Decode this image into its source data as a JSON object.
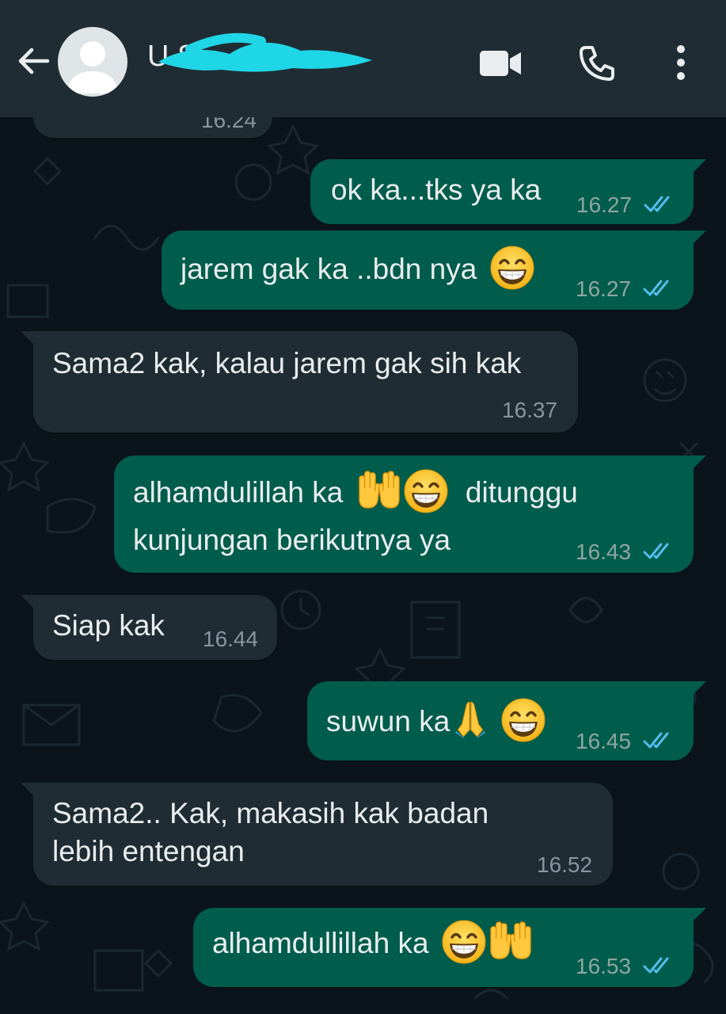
{
  "header": {
    "contact_name": "U                    S",
    "back_icon": "arrow-left-icon",
    "video_icon": "video-camera-icon",
    "call_icon": "phone-icon",
    "menu_icon": "more-vertical-icon"
  },
  "colors": {
    "header_bg": "#202c33",
    "chat_bg": "#0b141a",
    "outgoing_bubble": "#005c4b",
    "incoming_bubble": "#202c33",
    "read_ticks": "#53bdeb",
    "redaction": "#1fd6e6"
  },
  "messages": [
    {
      "direction": "in",
      "lines": [
        "",
        ""
      ],
      "time": "16.24"
    },
    {
      "direction": "out",
      "lines": [
        "ok ka...tks ya ka"
      ],
      "time": "16.27",
      "status": "read"
    },
    {
      "direction": "out",
      "lines": [
        "jarem gak ka ..bdn nya"
      ],
      "emojis": [
        "grinning-face-smiling-eyes"
      ],
      "time": "16.27",
      "status": "read"
    },
    {
      "direction": "in",
      "lines": [
        "Sama2 kak, kalau jarem gak sih kak"
      ],
      "time": "16.37"
    },
    {
      "direction": "out",
      "lines": [
        "alhamdulillah ka",
        "ditunggu",
        "kunjungan berikutnya ya"
      ],
      "emojis": [
        "palms-up-together",
        "grinning-face-smiling-eyes"
      ],
      "time": "16.43",
      "status": "read"
    },
    {
      "direction": "in",
      "lines": [
        "Siap kak"
      ],
      "time": "16.44"
    },
    {
      "direction": "out",
      "lines": [
        "suwun ka"
      ],
      "emojis": [
        "folded-hands",
        "grinning-face-smiling-eyes"
      ],
      "time": "16.45",
      "status": "read"
    },
    {
      "direction": "in",
      "lines": [
        "Sama2.. Kak, makasih kak badan",
        "lebih entengan"
      ],
      "time": "16.52"
    },
    {
      "direction": "out",
      "lines": [
        "alhamdullillah ka"
      ],
      "emojis": [
        "grinning-face-smiling-eyes",
        "palms-up-together"
      ],
      "time": "16.53",
      "status": "read"
    }
  ]
}
